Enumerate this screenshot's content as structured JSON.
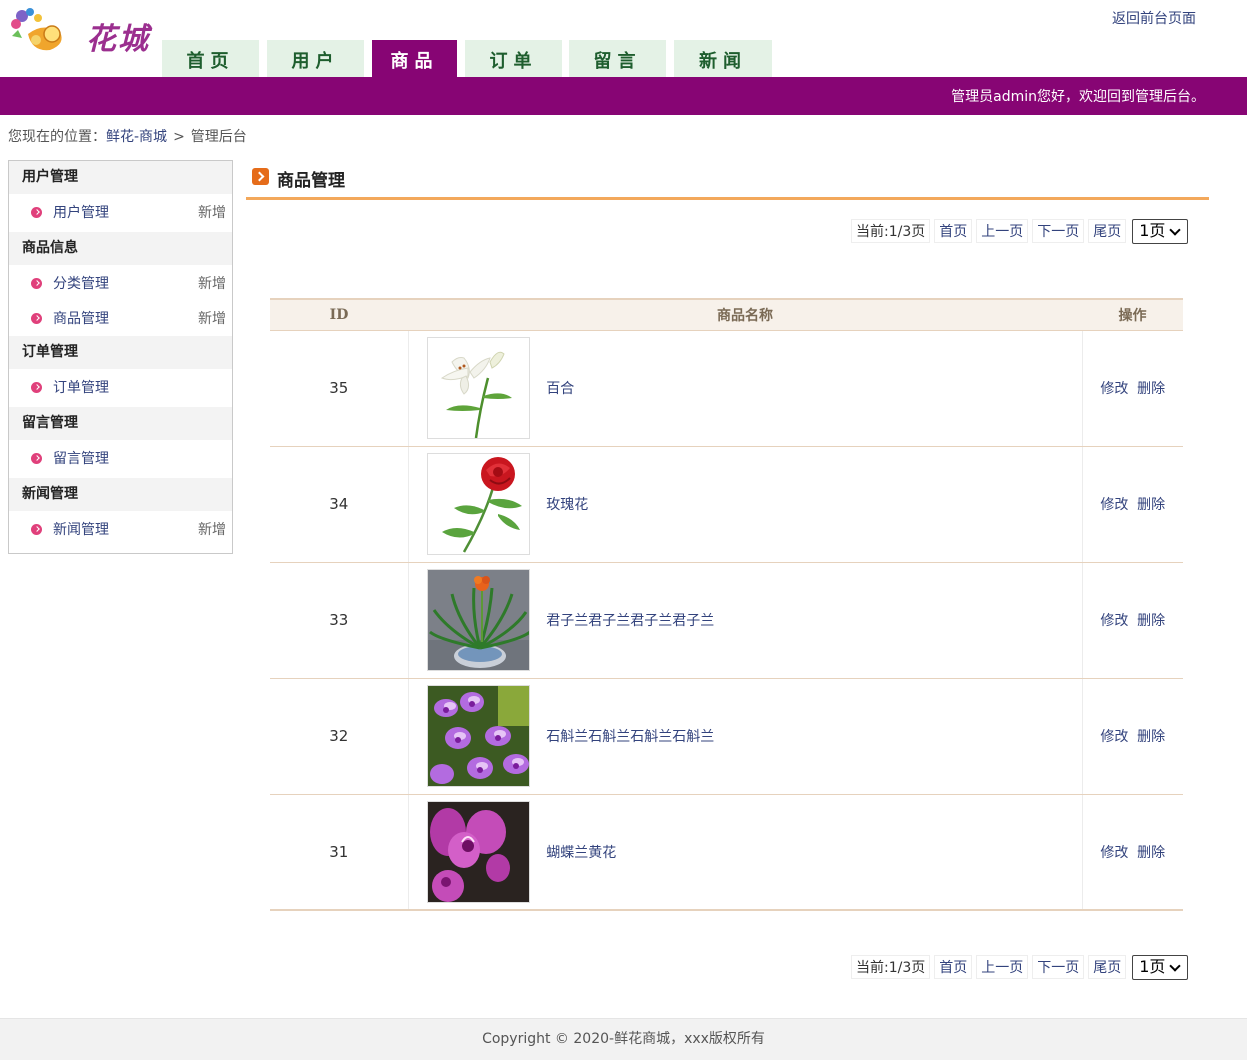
{
  "header": {
    "logo_text": "花城",
    "front_link": "返回前台页面",
    "welcome": "管理员admin您好，欢迎回到管理后台。"
  },
  "nav": {
    "tabs": [
      {
        "label": "首页",
        "active": false
      },
      {
        "label": "用户",
        "active": false
      },
      {
        "label": "商品",
        "active": true
      },
      {
        "label": "订单",
        "active": false
      },
      {
        "label": "留言",
        "active": false
      },
      {
        "label": "新闻",
        "active": false
      }
    ]
  },
  "breadcrumb": {
    "prefix": "您现在的位置：",
    "home": "鲜花-商城",
    "sep": ">",
    "current": "管理后台"
  },
  "sidebar": {
    "groups": [
      {
        "title": "用户管理",
        "items": [
          {
            "label": "用户管理",
            "add": "新增"
          }
        ]
      },
      {
        "title": "商品信息",
        "items": [
          {
            "label": "分类管理",
            "add": "新增"
          },
          {
            "label": "商品管理",
            "add": "新增"
          }
        ]
      },
      {
        "title": "订单管理",
        "items": [
          {
            "label": "订单管理",
            "add": ""
          }
        ]
      },
      {
        "title": "留言管理",
        "items": [
          {
            "label": "留言管理",
            "add": ""
          }
        ]
      },
      {
        "title": "新闻管理",
        "items": [
          {
            "label": "新闻管理",
            "add": "新增"
          }
        ]
      }
    ]
  },
  "main": {
    "title": "商品管理",
    "pager": {
      "info": "当前:1/3页",
      "first": "首页",
      "prev": "上一页",
      "next": "下一页",
      "last": "尾页",
      "select_value": "1页"
    },
    "table": {
      "headers": {
        "id": "ID",
        "name": "商品名称",
        "ops": "操作"
      },
      "rows": [
        {
          "id": "35",
          "name": "百合",
          "image": "lily"
        },
        {
          "id": "34",
          "name": "玫瑰花",
          "image": "rose"
        },
        {
          "id": "33",
          "name": "君子兰君子兰君子兰君子兰",
          "image": "clivia"
        },
        {
          "id": "32",
          "name": "石斛兰石斛兰石斛兰石斛兰",
          "image": "dendrobium"
        },
        {
          "id": "31",
          "name": "蝴蝶兰黄花",
          "image": "phalaenopsis"
        }
      ],
      "edit_label": "修改",
      "delete_label": "删除"
    }
  },
  "footer": {
    "copyright": "Copyright © 2020-鲜花商城，xxx版权所有"
  }
}
